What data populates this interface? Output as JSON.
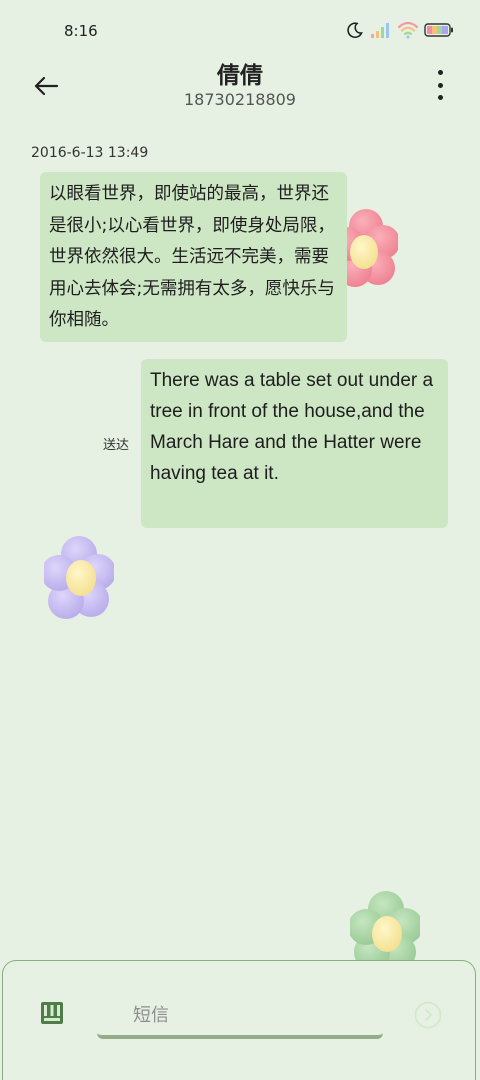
{
  "status_bar": {
    "time": "8:16"
  },
  "header": {
    "title": "倩倩",
    "subtitle": "18730218809"
  },
  "conversation": {
    "timestamp": "2016-6-13 13:49",
    "messages": [
      {
        "direction": "incoming",
        "text": "以眼看世界，即使站的最高，世界还是很小;以心看世界，即使身处局限，世界依然很大。生活远不完美，需要用心去体会;无需拥有太多，愿快乐与你相随。"
      },
      {
        "direction": "outgoing",
        "text": "There was a table set out under a tree in front of the house,and the March Hare and the Hatter were having tea at it.",
        "status": "送达"
      }
    ]
  },
  "composer": {
    "placeholder": "短信"
  },
  "colors": {
    "background": "#e6f1e4",
    "bubble": "#cde6c4",
    "accent": "#8aac82"
  }
}
